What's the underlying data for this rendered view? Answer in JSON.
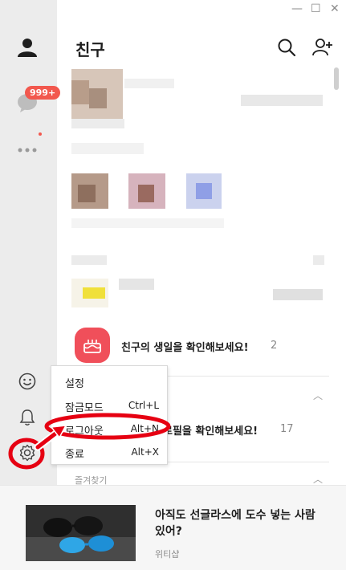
{
  "window": {
    "minimize_label": "—",
    "maximize_label": "☐",
    "close_label": "✕"
  },
  "sidebar": {
    "chat_badge": "999+",
    "top_items": [
      {
        "name": "friends",
        "icon": "person-icon"
      },
      {
        "name": "chats",
        "icon": "chat-bubble-icon"
      },
      {
        "name": "more",
        "icon": "more-dots-icon"
      }
    ],
    "bottom_items": [
      {
        "name": "emoticon",
        "icon": "smiley-icon"
      },
      {
        "name": "notifications",
        "icon": "bell-icon"
      },
      {
        "name": "settings",
        "icon": "gear-icon"
      }
    ]
  },
  "header": {
    "title": "친구",
    "icons": [
      "search-icon",
      "add-friend-icon"
    ]
  },
  "birthday": {
    "text": "친구의 생일을 확인해보세요!",
    "count": "2"
  },
  "profile_update": {
    "text": "로필을 확인해보세요!",
    "count": "17"
  },
  "favorites": {
    "label": "즐겨찾기"
  },
  "context_menu": {
    "items": [
      {
        "label": "설정",
        "shortcut": ""
      },
      {
        "label": "잠금모드",
        "shortcut": "Ctrl+L"
      },
      {
        "label": "로그아웃",
        "shortcut": "Alt+N"
      },
      {
        "label": "종료",
        "shortcut": "Alt+X"
      }
    ]
  },
  "ad": {
    "title": "아직도 선글라스에 도수 넣는 사람 있어?",
    "source": "위티샵"
  },
  "colors": {
    "sidebar_bg": "#ececec",
    "badge": "#f2584e",
    "birthday_icon_bg": "#f04f5a",
    "annotation_red": "#e60012"
  }
}
